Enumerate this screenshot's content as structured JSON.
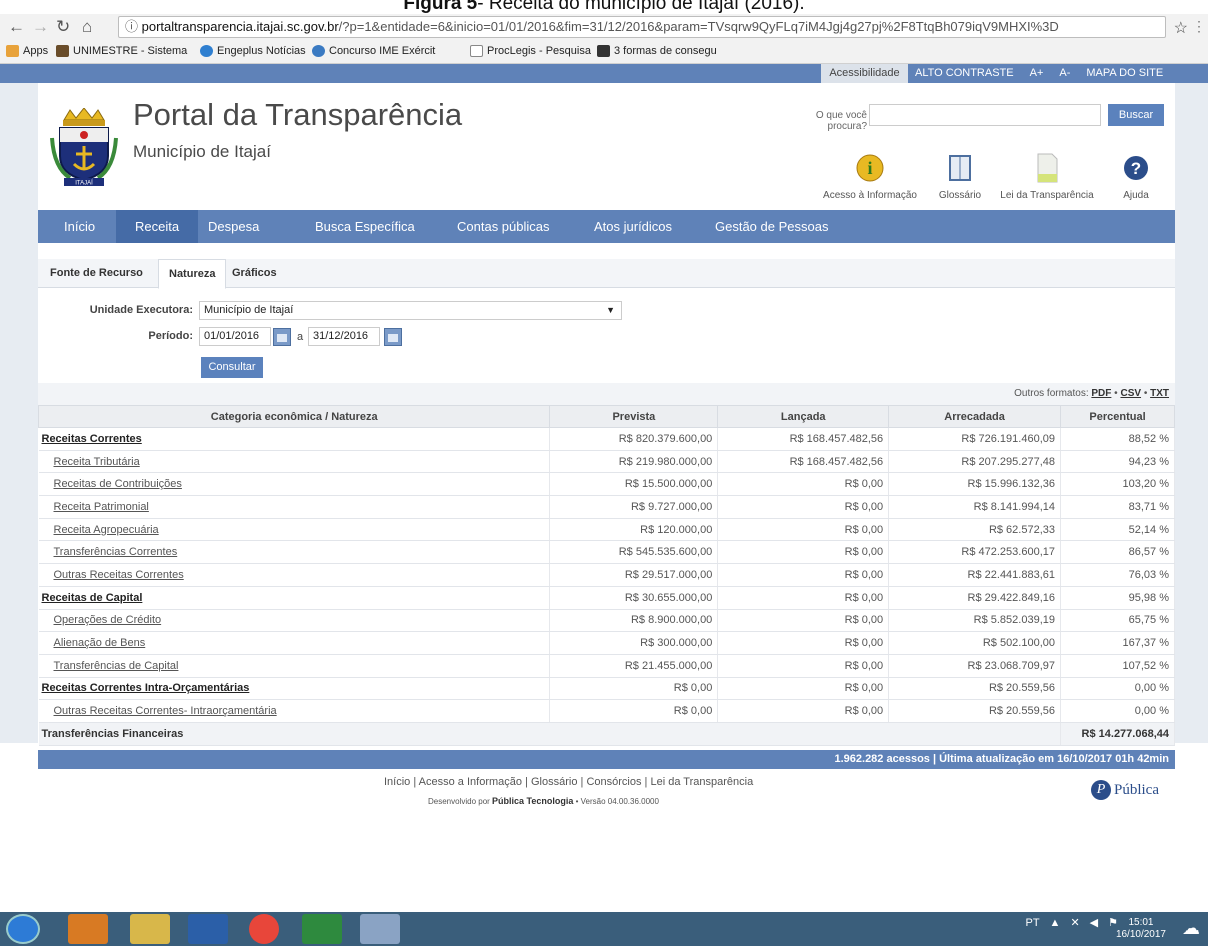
{
  "caption": {
    "figure": "Figura 5",
    "rest": " - Receita do município de Itajaí (2016)."
  },
  "browser": {
    "url_host": "portaltransparencia.itajai.sc.gov.br",
    "url_rest": "/?p=1&entidade=6&inicio=01/01/2016&fim=31/12/2016&param=TVsqrw9QyFLq7iM4Jgj4g27pj%2F8TtqBh079iqV9MHXI%3D",
    "bookmarks": [
      "Apps",
      "UNIMESTRE - Sistema",
      "Engeplus Notícias",
      "Concurso IME Exércit",
      "ProcLegis - Pesquisa",
      "3 formas de consegu"
    ]
  },
  "topbar": {
    "access": "Acessibilidade",
    "links": [
      "ALTO CONTRASTE",
      "A+",
      "A-",
      "MAPA DO SITE"
    ]
  },
  "header": {
    "title": "Portal da Transparência",
    "subtitle": "Município de Itajaí",
    "logo_text": "ITAJAÍ"
  },
  "search": {
    "label": "O que você procura?",
    "value": "",
    "button": "Buscar"
  },
  "quick_links": [
    "Acesso à Informação",
    "Glossário",
    "Lei da Transparência",
    "Ajuda"
  ],
  "menu": [
    "Início",
    "Receita",
    "Despesa",
    "Busca Específica",
    "Contas públicas",
    "Atos jurídicos",
    "Gestão de Pessoas"
  ],
  "tabs": [
    "Fonte de Recurso",
    "Natureza",
    "Gráficos"
  ],
  "form": {
    "unidade_label": "Unidade Executora:",
    "unidade_value": "Município de Itajaí",
    "periodo_label": "Período:",
    "date_from": "01/01/2016",
    "date_sep": "a",
    "date_to": "31/12/2016",
    "consult": "Consultar"
  },
  "formats": {
    "label": "Outros formatos:",
    "pdf": "PDF",
    "csv": "CSV",
    "txt": "TXT",
    "sep": "•"
  },
  "table": {
    "headers": [
      "Categoria econômica / Natureza",
      "Prevista",
      "Lançada",
      "Arrecadada",
      "Percentual"
    ],
    "rows": [
      {
        "level": "top",
        "cat": "Receitas Correntes",
        "prevista": "R$ 820.379.600,00",
        "lancada": "R$ 168.457.482,56",
        "arrecadada": "R$ 726.191.460,09",
        "percentual": "88,52 %"
      },
      {
        "level": "sub",
        "cat": "Receita Tributária",
        "prevista": "R$ 219.980.000,00",
        "lancada": "R$ 168.457.482,56",
        "arrecadada": "R$ 207.295.277,48",
        "percentual": "94,23 %"
      },
      {
        "level": "sub",
        "cat": "Receitas de Contribuições",
        "prevista": "R$ 15.500.000,00",
        "lancada": "R$ 0,00",
        "arrecadada": "R$ 15.996.132,36",
        "percentual": "103,20 %"
      },
      {
        "level": "sub",
        "cat": "Receita Patrimonial",
        "prevista": "R$ 9.727.000,00",
        "lancada": "R$ 0,00",
        "arrecadada": "R$ 8.141.994,14",
        "percentual": "83,71 %"
      },
      {
        "level": "sub",
        "cat": "Receita Agropecuária",
        "prevista": "R$ 120.000,00",
        "lancada": "R$ 0,00",
        "arrecadada": "R$ 62.572,33",
        "percentual": "52,14 %"
      },
      {
        "level": "sub",
        "cat": "Transferências Correntes",
        "prevista": "R$ 545.535.600,00",
        "lancada": "R$ 0,00",
        "arrecadada": "R$ 472.253.600,17",
        "percentual": "86,57 %"
      },
      {
        "level": "sub",
        "cat": "Outras Receitas Correntes",
        "prevista": "R$ 29.517.000,00",
        "lancada": "R$ 0,00",
        "arrecadada": "R$ 22.441.883,61",
        "percentual": "76,03 %"
      },
      {
        "level": "top",
        "cat": "Receitas de Capital",
        "prevista": "R$ 30.655.000,00",
        "lancada": "R$ 0,00",
        "arrecadada": "R$ 29.422.849,16",
        "percentual": "95,98 %"
      },
      {
        "level": "sub",
        "cat": "Operações de Crédito",
        "prevista": "R$ 8.900.000,00",
        "lancada": "R$ 0,00",
        "arrecadada": "R$ 5.852.039,19",
        "percentual": "65,75 %"
      },
      {
        "level": "sub",
        "cat": "Alienação de Bens",
        "prevista": "R$ 300.000,00",
        "lancada": "R$ 0,00",
        "arrecadada": "R$ 502.100,00",
        "percentual": "167,37 %"
      },
      {
        "level": "sub",
        "cat": "Transferências de Capital",
        "prevista": "R$ 21.455.000,00",
        "lancada": "R$ 0,00",
        "arrecadada": "R$ 23.068.709,97",
        "percentual": "107,52 %"
      },
      {
        "level": "top",
        "cat": "Receitas Correntes Intra-Orçamentárias",
        "prevista": "R$ 0,00",
        "lancada": "R$ 0,00",
        "arrecadada": "R$ 20.559,56",
        "percentual": "0,00 %"
      },
      {
        "level": "sub",
        "cat": "Outras Receitas Correntes- Intraorçamentária",
        "prevista": "R$ 0,00",
        "lancada": "R$ 0,00",
        "arrecadada": "R$ 20.559,56",
        "percentual": "0,00 %"
      }
    ],
    "transfer_label": "Transferências Financeiras",
    "transfer_value": "R$ 14.277.068,44"
  },
  "status": "1.962.282 acessos | Última atualização em 16/10/2017 01h 42min",
  "footer": {
    "links": [
      "Início",
      "Acesso a Informação",
      "Glossário",
      "Consórcios",
      "Lei da Transparência"
    ],
    "dev_prefix": "Desenvolvido por ",
    "dev_company": "Pública Tecnologia",
    "dev_version": " • Versão 04.00.36.0000",
    "brand": "Pública"
  },
  "taskbar": {
    "lang": "PT",
    "time": "15:01",
    "date": "16/10/2017"
  },
  "colors": {
    "primary": "#5f82b8",
    "active": "#456ba6",
    "button": "#5b82bd"
  }
}
